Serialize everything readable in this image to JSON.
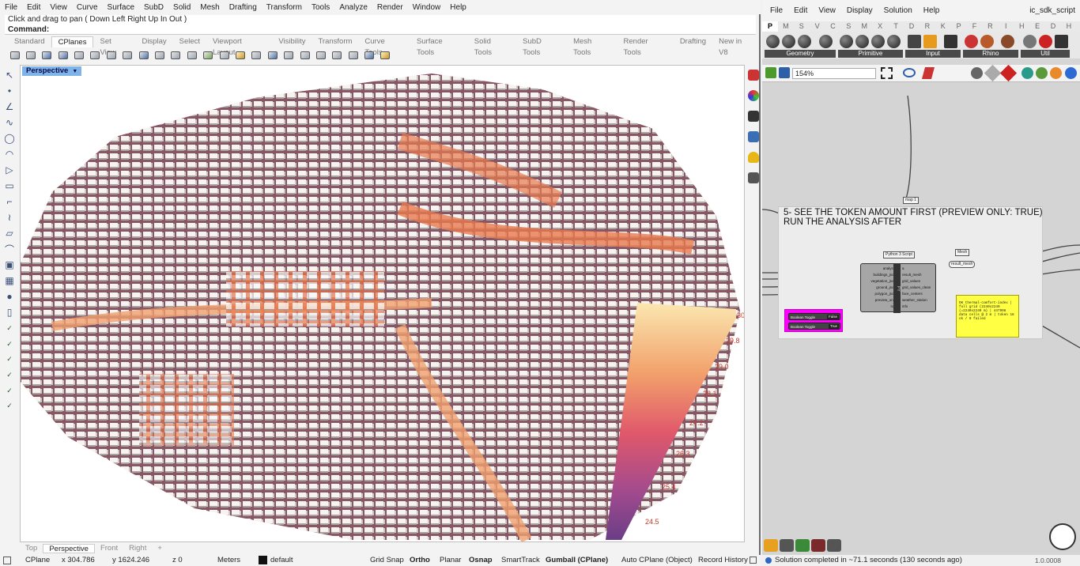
{
  "rhino": {
    "menu": [
      "File",
      "Edit",
      "View",
      "Curve",
      "Surface",
      "SubD",
      "Solid",
      "Mesh",
      "Drafting",
      "Transform",
      "Tools",
      "Analyze",
      "Render",
      "Window",
      "Help"
    ],
    "command_history": "Click and drag to pan ( Down  Left  Right  Up  In  Out )",
    "command_prompt": "Command:",
    "tabs": [
      "Standard",
      "CPlanes",
      "Set View",
      "Display",
      "Select",
      "Viewport Layout",
      "Visibility",
      "Transform",
      "Curve Tools",
      "Surface Tools",
      "Solid Tools",
      "SubD Tools",
      "Mesh Tools",
      "Render Tools",
      "Drafting",
      "New in V8"
    ],
    "active_tab": "CPlanes",
    "viewport_title": "Perspective",
    "legend_values": [
      "30",
      "29.8",
      "29.0",
      "28.1",
      "27.2",
      "26.3",
      "25.4",
      "24.5"
    ],
    "view_tabs": [
      "Top",
      "Perspective",
      "Front",
      "Right",
      "+"
    ],
    "active_view": "Perspective",
    "status": {
      "cplane": "CPlane",
      "x": "x 304.786",
      "y": "y 1624.246",
      "z": "z 0",
      "units": "Meters",
      "layer": "default",
      "grid_snap": "Grid Snap",
      "ortho": "Ortho",
      "planar": "Planar",
      "osnap": "Osnap",
      "smarttrack": "SmartTrack",
      "gumball": "Gumball (CPlane)",
      "autocplane": "Auto CPlane (Object)",
      "record": "Record History"
    }
  },
  "gh": {
    "menu": [
      "File",
      "Edit",
      "View",
      "Display",
      "Solution",
      "Help"
    ],
    "file_title": "ic_sdk_script",
    "tabs": [
      "P",
      "M",
      "S",
      "V",
      "C",
      "S",
      "M",
      "X",
      "T",
      "D",
      "R",
      "K",
      "P",
      "F",
      "R",
      "I",
      "H",
      "E",
      "D",
      "H"
    ],
    "groups": [
      "Geometry",
      "Primitive",
      "Input",
      "Rhino",
      "Util"
    ],
    "zoom": "154%",
    "note": "5- SEE THE TOKEN AMOUNT FIRST (PREVIEW ONLY: TRUE) RUN THE ANALYSIS AFTER",
    "label_top": "map 1",
    "component_title": "Python 3 Script",
    "mesh_label": "Mesh",
    "result_mesh": "result_mesh",
    "inputs": [
      "analysis",
      "buildings_json",
      "vegetation_json",
      "ground_json",
      "polygon_json",
      "preview_only",
      "run"
    ],
    "outputs": [
      "a",
      "result_mesh",
      "grid_values",
      "grid_values_clean",
      "face_centers",
      "weather_station",
      "info"
    ],
    "toggles": [
      {
        "label": "Boolean Toggle",
        "value": "False"
      },
      {
        "label": "Boolean Toggle",
        "value": "True"
      }
    ],
    "panel_text": "OK  thermal-comfort-index | full grid (2240x2240 (=2240x2240 m) | 447998 data cells @ 2 m | token 18 ok / 0 failed",
    "status": "Solution completed in ~71.1 seconds (130 seconds ago)",
    "version": "1.0.0008"
  }
}
